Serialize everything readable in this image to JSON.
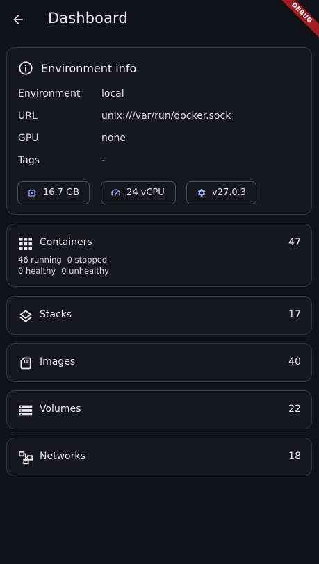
{
  "appbar": {
    "title": "Dashboard",
    "debug_banner": "DEBUG"
  },
  "environment": {
    "header": "Environment info",
    "rows": [
      {
        "key": "Environment",
        "value": "local"
      },
      {
        "key": "URL",
        "value": "unix:///var/run/docker.sock"
      },
      {
        "key": "GPU",
        "value": "none"
      },
      {
        "key": "Tags",
        "value": "-"
      }
    ],
    "chips": [
      {
        "icon": "memory-chip-icon",
        "label": "16.7 GB"
      },
      {
        "icon": "speedometer-icon",
        "label": "24 vCPU"
      },
      {
        "icon": "gear-icon",
        "label": "v27.0.3"
      }
    ]
  },
  "containers": {
    "label": "Containers",
    "count": "47",
    "running": "46 running",
    "stopped": "0 stopped",
    "healthy": "0 healthy",
    "unhealthy": "0 unhealthy"
  },
  "resources": [
    {
      "icon": "layers-icon",
      "label": "Stacks",
      "count": "17"
    },
    {
      "icon": "sd-card-icon",
      "label": "Images",
      "count": "40"
    },
    {
      "icon": "storage-icon",
      "label": "Volumes",
      "count": "22"
    },
    {
      "icon": "network-icon",
      "label": "Networks",
      "count": "18"
    }
  ],
  "colors": {
    "background": "#121318",
    "card": "#17181e",
    "chip_icon": "#9fb4ff",
    "debug": "#a31d23"
  }
}
